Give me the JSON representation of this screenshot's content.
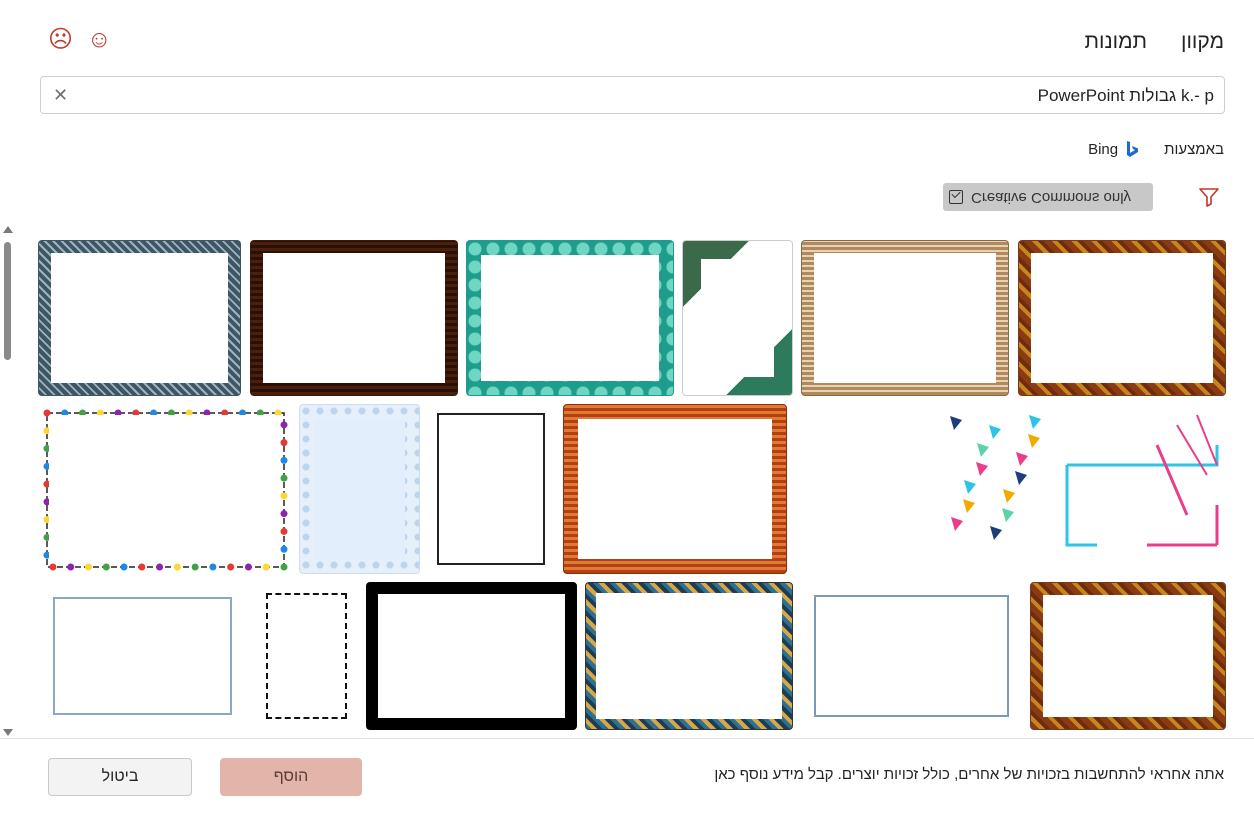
{
  "header": {
    "tabs": [
      "מקוון",
      "תמונות"
    ],
    "feedback": [
      "☺",
      "☹"
    ]
  },
  "search": {
    "value": "k.- p גבולות PowerPoint",
    "clear_glyph": "✕"
  },
  "powered_by": {
    "label": "באמצעות",
    "provider": "Bing"
  },
  "filter": {
    "creative_commons_label": "Creative Commons only",
    "creative_commons_checked": true
  },
  "results": {
    "rows": [
      [
        {
          "name": "gold-leaf-frame",
          "style": "autumn"
        },
        {
          "name": "tan-wood-frame",
          "style": "tan"
        },
        {
          "name": "green-geometric-frame",
          "style": "geo"
        },
        {
          "name": "teal-bubble-frame",
          "style": "teal"
        },
        {
          "name": "dark-wood-frame",
          "style": "darkwood"
        },
        {
          "name": "slate-stone-frame",
          "style": "slate"
        }
      ],
      [
        {
          "name": "neon-lines-frame",
          "style": "neon"
        },
        {
          "name": "confetti-triangles-frame",
          "style": "confetti"
        },
        {
          "name": "orange-wood-frame",
          "style": "orangewood"
        },
        {
          "name": "black-corner-ornament-frame",
          "style": "ornament"
        },
        {
          "name": "blue-floral-frame",
          "style": "bluefloral"
        },
        {
          "name": "christmas-lights-frame",
          "style": "lights"
        }
      ],
      [
        {
          "name": "autumn-leaf-frame-2",
          "style": "autumn"
        },
        {
          "name": "thin-blue-floral-frame",
          "style": "thinfloral"
        },
        {
          "name": "mosaic-tile-frame",
          "style": "mosaic"
        },
        {
          "name": "black-lattice-frame",
          "style": "lattice"
        },
        {
          "name": "black-flourish-frame",
          "style": "flourish"
        },
        {
          "name": "blue-diamond-frame",
          "style": "bluediamond"
        }
      ]
    ]
  },
  "footer": {
    "notice": "אתה אחראי להתחשבות בזכויות של אחרים, כולל זכויות יוצרים. קבל מידע נוסף כאן",
    "insert_label": "הוסף",
    "cancel_label": "ביטול"
  },
  "colors": {
    "accent": "#c0392b",
    "insert_bg": "#e3b5aa",
    "chip_bg": "#c8c8c8"
  }
}
